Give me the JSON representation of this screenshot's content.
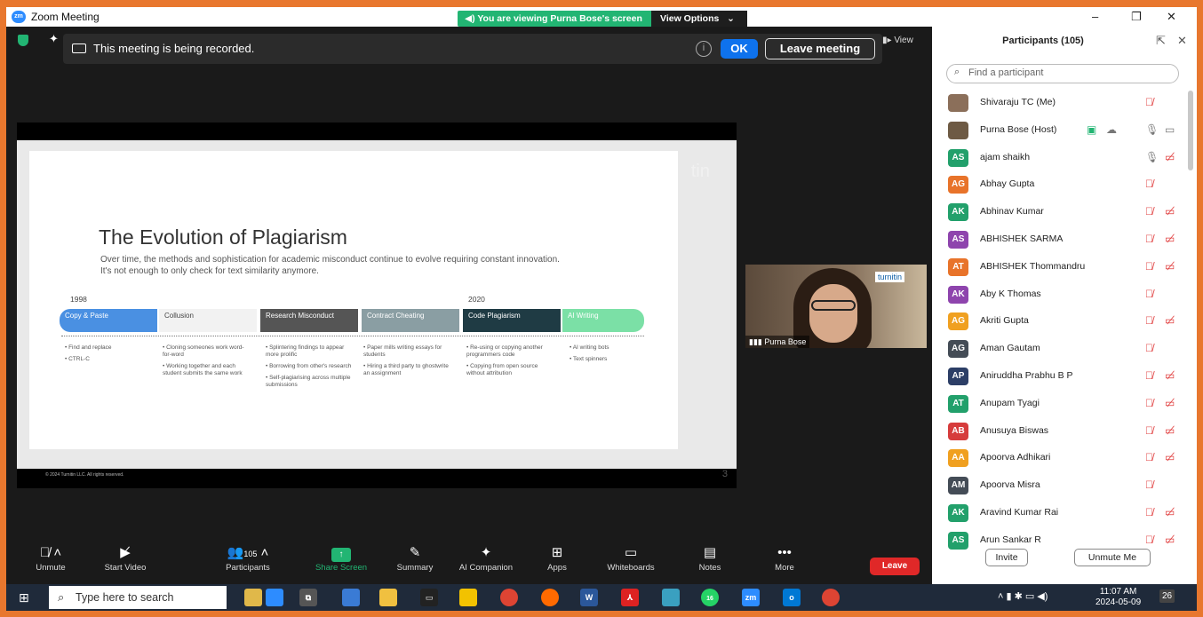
{
  "window": {
    "title": "Zoom Meeting",
    "logo": "zm",
    "viewing_banner": "You are viewing Purna Bose's screen",
    "view_options": "View Options",
    "controls": [
      "–",
      "❐",
      "✕"
    ]
  },
  "recording": {
    "message": "This meeting is being recorded.",
    "ok_label": "OK",
    "leave_label": "Leave meeting",
    "view_label": "View"
  },
  "slide": {
    "title": "The Evolution of Plagiarism",
    "subtitle": "Over time, the methods and sophistication for academic misconduct continue to evolve requiring constant innovation. It's not enough to only check for text similarity anymore.",
    "year_start": "1998",
    "year_mid": "2020",
    "stages": [
      {
        "label": "Copy & Paste",
        "color": "#4a90e2",
        "text_color": "#ffffff"
      },
      {
        "label": "Collusion",
        "color": "#f2f2f2",
        "text_color": "#444444"
      },
      {
        "label": "Research Misconduct",
        "color": "#555555",
        "text_color": "#ffffff"
      },
      {
        "label": "Contract Cheating",
        "color": "#8a9ea3",
        "text_color": "#ffffff"
      },
      {
        "label": "Code Plagiarism",
        "color": "#1f3b44",
        "text_color": "#ffffff"
      },
      {
        "label": "AI Writing",
        "color": "#7be0a6",
        "text_color": "#ffffff"
      }
    ],
    "bullets": [
      [
        "• Find and replace",
        "• CTRL-C"
      ],
      [
        "• Cloning someones work word-for-word",
        "• Working together and each student submits the same work"
      ],
      [
        "• Splintering findings to appear more prolific",
        "• Borrowing from other's research",
        "• Self-plagiarising across multiple submissions"
      ],
      [
        "• Paper mills writing essays for students",
        "• Hiring a third party to ghostwrite an assignment"
      ],
      [
        "• Re-using or copying another programmers code",
        "• Copying from open source without attribution"
      ],
      [
        "• AI writing bots",
        "• Text spinners"
      ]
    ],
    "footer": "© 2024 Turnitin LLC. All rights reserved.",
    "page": "3",
    "watermark": "tin"
  },
  "speaker": {
    "name": "Purna Bose",
    "brand": "turnitin"
  },
  "toolbar": {
    "items": [
      {
        "label": "Unmute",
        "icon": "mic-muted-icon"
      },
      {
        "label": "Start Video",
        "icon": "video-off-icon"
      },
      {
        "label": "Participants",
        "icon": "people-icon",
        "count": "105"
      },
      {
        "label": "Share Screen",
        "icon": "share-icon"
      },
      {
        "label": "Summary",
        "icon": "summary-icon"
      },
      {
        "label": "AI Companion",
        "icon": "ai-icon"
      },
      {
        "label": "Apps",
        "icon": "apps-icon"
      },
      {
        "label": "Whiteboards",
        "icon": "whiteboard-icon"
      },
      {
        "label": "Notes",
        "icon": "notes-icon"
      },
      {
        "label": "More",
        "icon": "more-icon"
      }
    ],
    "leave": "Leave"
  },
  "participants": {
    "title": "Participants (105)",
    "search_placeholder": "Find a participant",
    "list": [
      {
        "initials": "",
        "name": "Shivaraju TC (Me)",
        "color": "#8b6f5a",
        "photo": true,
        "mic_muted": true,
        "video_off": false
      },
      {
        "initials": "",
        "name": "Purna Bose (Host)",
        "color": "#6e5a44",
        "photo": true,
        "mic_muted": false,
        "video_off": false,
        "host": true
      },
      {
        "initials": "AS",
        "name": "ajam shaikh",
        "color": "#22a06b",
        "mic_muted": false,
        "video_off": true
      },
      {
        "initials": "AG",
        "name": "Abhay Gupta",
        "color": "#e8732a",
        "mic_muted": true,
        "video_off": false
      },
      {
        "initials": "AK",
        "name": "Abhinav Kumar",
        "color": "#22a06b",
        "mic_muted": true,
        "video_off": true
      },
      {
        "initials": "AS",
        "name": "ABHISHEK SARMA",
        "color": "#8e44ad",
        "mic_muted": true,
        "video_off": true
      },
      {
        "initials": "AT",
        "name": "ABHISHEK Thommandru",
        "color": "#e8732a",
        "mic_muted": true,
        "video_off": true
      },
      {
        "initials": "AK",
        "name": "Aby K Thomas",
        "color": "#8e44ad",
        "mic_muted": true,
        "video_off": false
      },
      {
        "initials": "AG",
        "name": "Akriti Gupta",
        "color": "#f0a020",
        "mic_muted": true,
        "video_off": true
      },
      {
        "initials": "AG",
        "name": "Aman Gautam",
        "color": "#444c56",
        "mic_muted": true,
        "video_off": false
      },
      {
        "initials": "AP",
        "name": "Aniruddha Prabhu B P",
        "color": "#2c3e66",
        "mic_muted": true,
        "video_off": true
      },
      {
        "initials": "AT",
        "name": "Anupam Tyagi",
        "color": "#22a06b",
        "mic_muted": true,
        "video_off": true
      },
      {
        "initials": "AB",
        "name": "Anusuya Biswas",
        "color": "#d63c3c",
        "mic_muted": true,
        "video_off": true
      },
      {
        "initials": "AA",
        "name": "Apoorva Adhikari",
        "color": "#f0a020",
        "mic_muted": true,
        "video_off": true
      },
      {
        "initials": "AM",
        "name": "Apoorva Misra",
        "color": "#444c56",
        "mic_muted": true,
        "video_off": false
      },
      {
        "initials": "AK",
        "name": "Aravind Kumar Rai",
        "color": "#22a06b",
        "mic_muted": true,
        "video_off": true
      },
      {
        "initials": "AS",
        "name": "Arun Sankar R",
        "color": "#22a06b",
        "mic_muted": true,
        "video_off": true
      }
    ],
    "invite": "Invite",
    "unmute_me": "Unmute Me"
  },
  "taskbar": {
    "search_placeholder": "Type here to search",
    "time": "11:07 AM",
    "date": "2024-05-09",
    "whatsapp_badge": "16",
    "notif_badge": "26"
  }
}
